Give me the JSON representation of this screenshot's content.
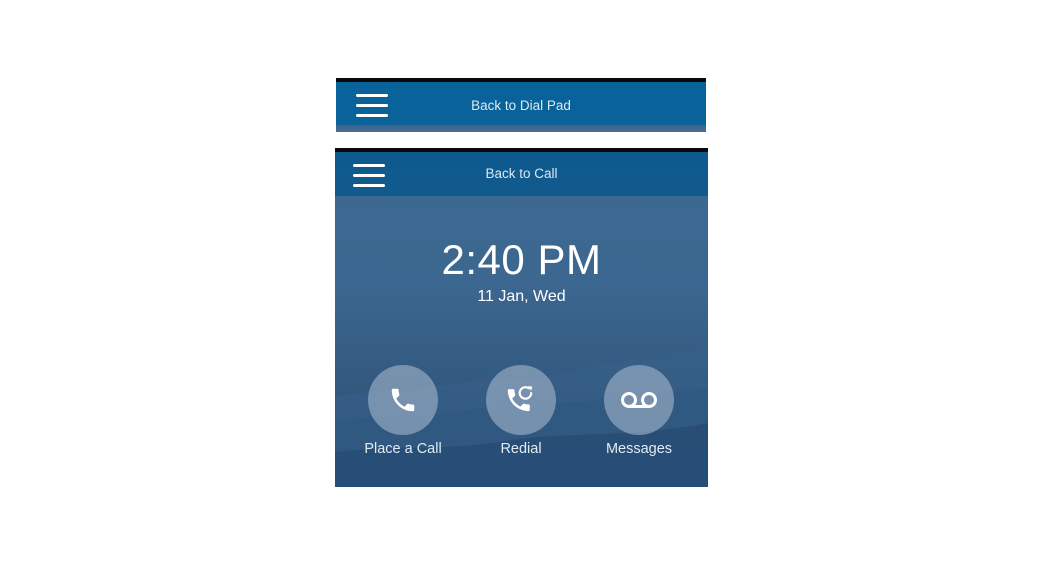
{
  "top_banner": {
    "label": "Back to Dial Pad",
    "menu_icon": "hamburger-menu-icon"
  },
  "screen": {
    "header": {
      "label": "Back to Call",
      "menu_icon": "hamburger-menu-icon"
    },
    "time": "2:40 PM",
    "date": "11 Jan, Wed",
    "actions": [
      {
        "label": "Place a Call",
        "icon": "phone-icon"
      },
      {
        "label": "Redial",
        "icon": "redial-icon"
      },
      {
        "label": "Messages",
        "icon": "voicemail-icon"
      }
    ]
  },
  "colors": {
    "header_blue": "#09629a",
    "screen_background": "#3b6992",
    "button_circle": "#afc0d2"
  }
}
